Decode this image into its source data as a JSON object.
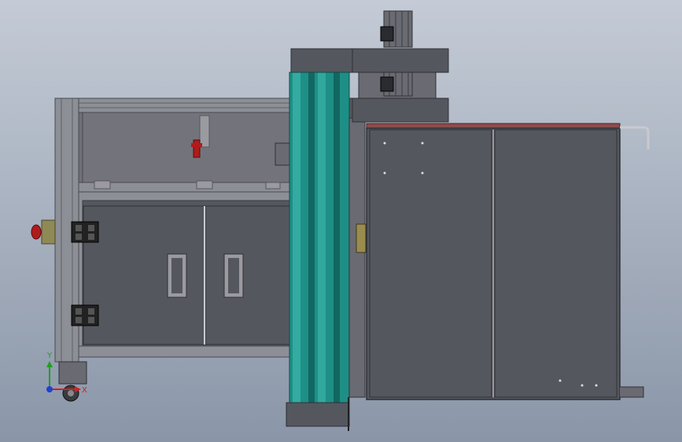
{
  "viewport": {
    "background_top": "#c4cbd6",
    "background_bottom": "#8a96a8"
  },
  "colors": {
    "frame": "#8d8f96",
    "frame_dark": "#5f6168",
    "panel": "#55575f",
    "panel_dark": "#3f4148",
    "roller": "#1e8f86",
    "roller_light": "#39b2a6",
    "roller_dark": "#10635d",
    "accent_red": "#b01c1c",
    "top_strip": "#8b4c4c"
  },
  "triad": {
    "x_label": "X",
    "y_label": "Y",
    "x_color": "#d42020",
    "y_color": "#20a020",
    "z_color": "#2040d0"
  }
}
